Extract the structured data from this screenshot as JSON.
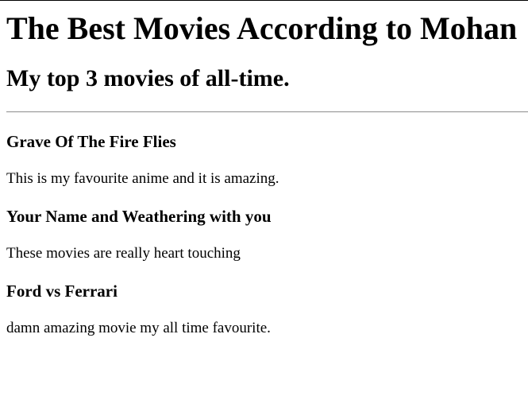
{
  "page": {
    "title": "The Best Movies According to Mohan",
    "subtitle": "My top 3 movies of all-time."
  },
  "movies": [
    {
      "title": "Grave Of The Fire Flies",
      "description": "This is my favourite anime and it is amazing."
    },
    {
      "title": "Your Name and Weathering with you",
      "description": "These movies are really heart touching"
    },
    {
      "title": "Ford vs Ferrari",
      "description": "damn amazing movie my all time favourite."
    }
  ]
}
